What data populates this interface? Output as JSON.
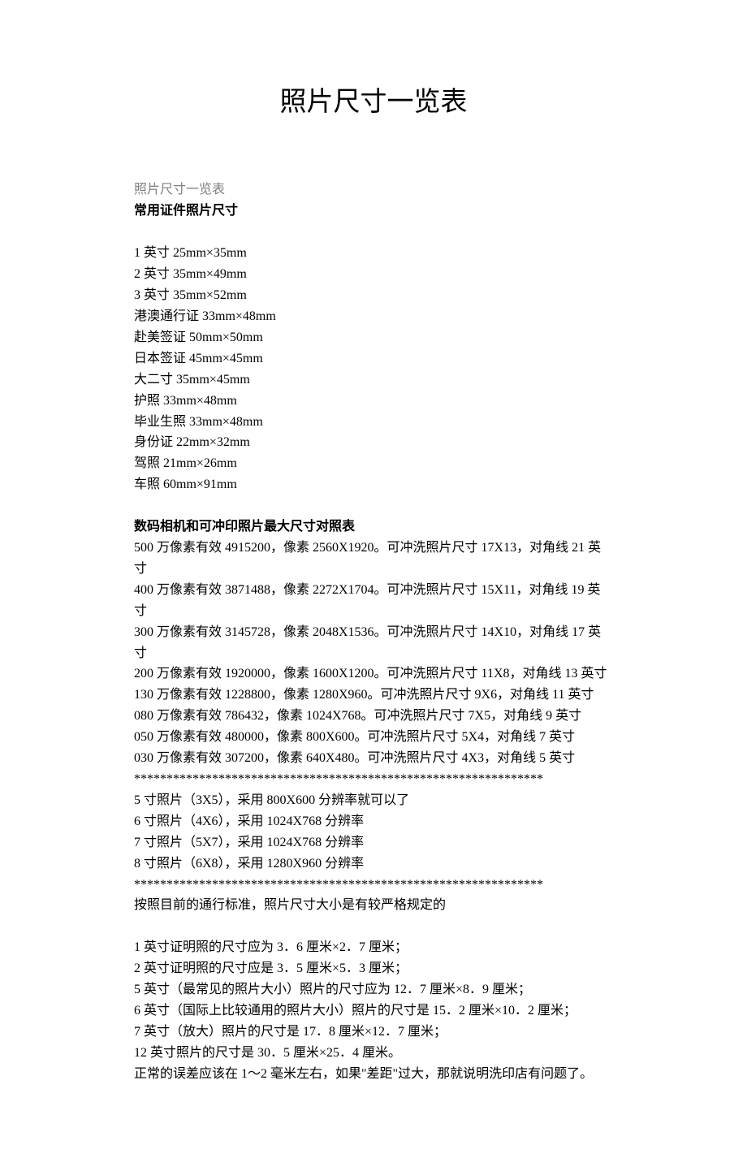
{
  "title": "照片尺寸一览表",
  "intro_gray": "照片尺寸一览表",
  "header_common": "常用证件照片尺寸",
  "common_sizes": [
    "1 英寸 25mm×35mm",
    "2 英寸 35mm×49mm",
    "3 英寸 35mm×52mm",
    "港澳通行证 33mm×48mm",
    "赴美签证 50mm×50mm",
    "日本签证 45mm×45mm",
    "大二寸 35mm×45mm",
    "护照 33mm×48mm",
    "毕业生照 33mm×48mm",
    "身份证 22mm×32mm",
    "驾照 21mm×26mm",
    "车照 60mm×91mm"
  ],
  "header_camera": "数码相机和可冲印照片最大尺寸对照表",
  "camera_lines": [
    "500 万像素有效 4915200，像素 2560X1920。可冲洗照片尺寸 17X13，对角线 21 英寸",
    "400 万像素有效 3871488，像素 2272X1704。可冲洗照片尺寸 15X11，对角线 19 英寸",
    "300 万像素有效 3145728，像素 2048X1536。可冲洗照片尺寸 14X10，对角线 17 英寸",
    "200 万像素有效 1920000，像素 1600X1200。可冲洗照片尺寸 11X8，对角线 13 英寸",
    "130 万像素有效 1228800，像素 1280X960。可冲洗照片尺寸 9X6，对角线 11 英寸",
    "080 万像素有效 786432，像素 1024X768。可冲洗照片尺寸 7X5，对角线 9 英寸",
    "050 万像素有效 480000，像素 800X600。可冲洗照片尺寸 5X4，对角线 7 英寸",
    "030 万像素有效 307200，像素 640X480。可冲洗照片尺寸 4X3，对角线 5 英寸"
  ],
  "sep1": "***************************************************************",
  "resolution_lines": [
    "5 寸照片（3X5），采用 800X600 分辨率就可以了",
    "6 寸照片（4X6），采用 1024X768 分辨率",
    "7 寸照片（5X7），采用 1024X768 分辨率",
    "8 寸照片（6X8），采用 1280X960 分辨率"
  ],
  "sep2": "***************************************************************",
  "standard_intro": "按照目前的通行标准，照片尺寸大小是有较严格规定的",
  "standard_lines": [
    "1 英寸证明照的尺寸应为 3．6 厘米×2．7 厘米；",
    "2 英寸证明照的尺寸应是 3．5 厘米×5．3 厘米；",
    "5 英寸（最常见的照片大小）照片的尺寸应为 12．7 厘米×8．9 厘米；",
    "6 英寸（国际上比较通用的照片大小）照片的尺寸是 15．2 厘米×10．2 厘米；",
    "7 英寸（放大）照片的尺寸是 17．8 厘米×12．7 厘米；",
    "12 英寸照片的尺寸是 30．5 厘米×25．4 厘米。",
    "正常的误差应该在 1～2 毫米左右，如果\"差距\"过大，那就说明洗印店有问题了。"
  ]
}
